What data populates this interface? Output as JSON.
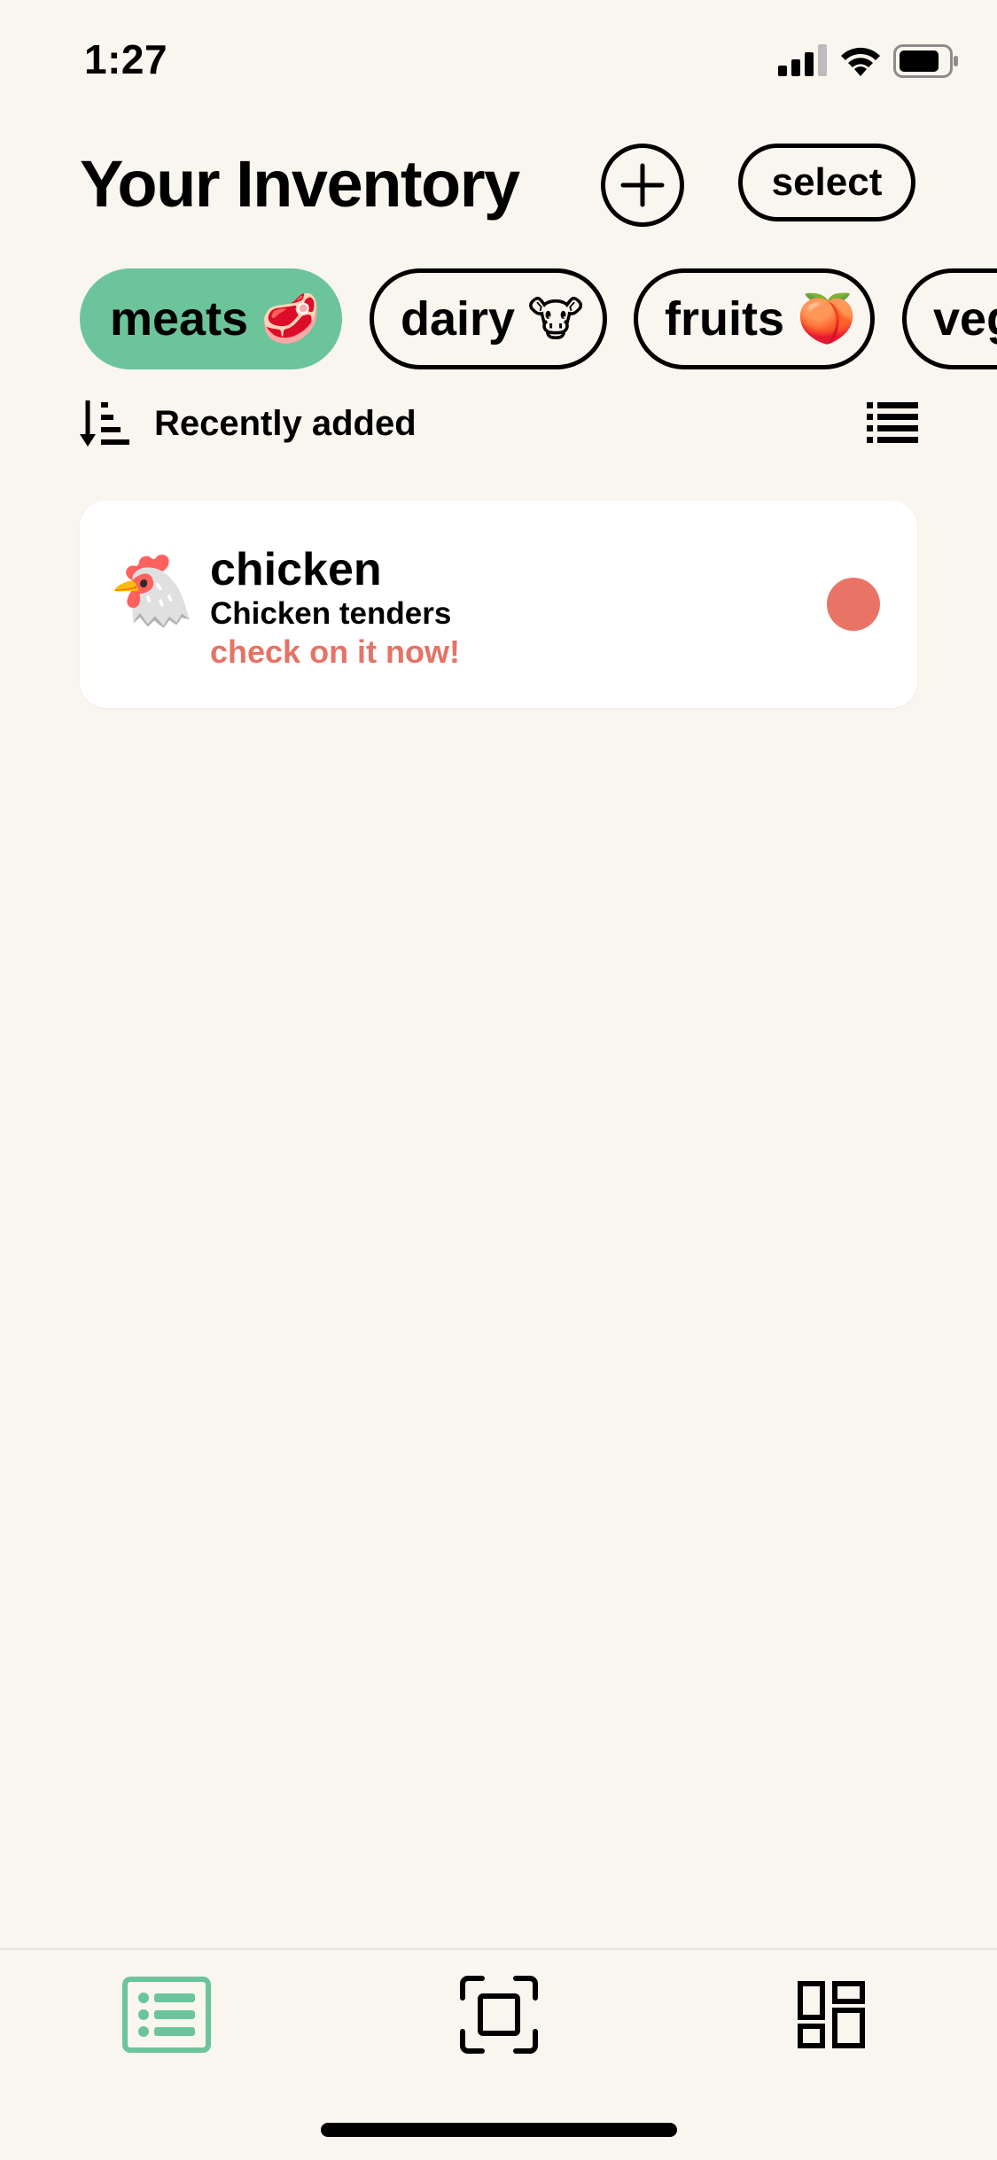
{
  "status_bar": {
    "time": "1:27"
  },
  "header": {
    "title": "Your Inventory",
    "select_label": "select"
  },
  "categories": [
    {
      "label": "meats",
      "emoji": "🥩",
      "active": true
    },
    {
      "label": "dairy",
      "emoji": "🐮",
      "active": false
    },
    {
      "label": "fruits",
      "emoji": "🍑",
      "active": false
    },
    {
      "label": "veg",
      "emoji": "",
      "active": false
    }
  ],
  "sort": {
    "label": "Recently added"
  },
  "items": [
    {
      "emoji": "🐔",
      "name": "chicken",
      "description": "Chicken tenders",
      "alert": "check on it now!",
      "status_color": "#e97466"
    }
  ],
  "colors": {
    "accent": "#6cc49b",
    "alert": "#e57366",
    "background": "#f8f6ee"
  },
  "tab_bar": {
    "tabs": [
      {
        "icon": "list-icon",
        "active": true
      },
      {
        "icon": "scan-icon",
        "active": false
      },
      {
        "icon": "dashboard-icon",
        "active": false
      }
    ]
  }
}
